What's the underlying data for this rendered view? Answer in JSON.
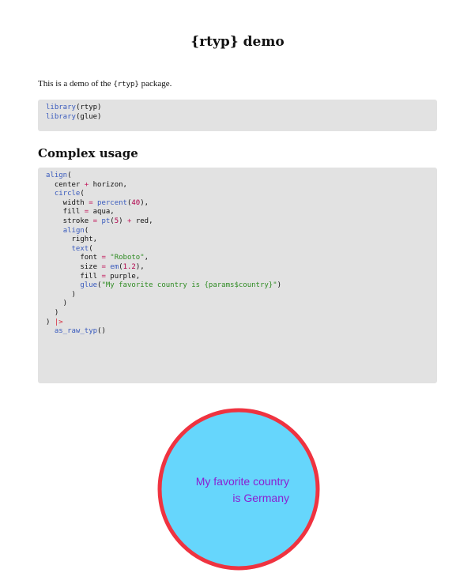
{
  "title": "{rtyp} demo",
  "intro": {
    "before": "This is a demo of the ",
    "package": "{rtyp}",
    "after": " package."
  },
  "setup_code": [
    [
      {
        "t": "library",
        "c": "fn"
      },
      {
        "t": "(rtyp)"
      }
    ],
    [
      {
        "t": "library",
        "c": "fn"
      },
      {
        "t": "(glue)"
      }
    ]
  ],
  "section_heading": "Complex usage",
  "usage_code": [
    [
      {
        "t": "align",
        "c": "fn"
      },
      {
        "t": "("
      }
    ],
    [
      {
        "t": "  center "
      },
      {
        "t": "+",
        "c": "op"
      },
      {
        "t": " horizon,"
      }
    ],
    [
      {
        "t": "  "
      },
      {
        "t": "circle",
        "c": "fn"
      },
      {
        "t": "("
      }
    ],
    [
      {
        "t": "    width "
      },
      {
        "t": "=",
        "c": "op"
      },
      {
        "t": " "
      },
      {
        "t": "percent",
        "c": "fn"
      },
      {
        "t": "("
      },
      {
        "t": "40",
        "c": "num"
      },
      {
        "t": "),"
      }
    ],
    [
      {
        "t": "    fill "
      },
      {
        "t": "=",
        "c": "op"
      },
      {
        "t": " aqua,"
      }
    ],
    [
      {
        "t": "    stroke "
      },
      {
        "t": "=",
        "c": "op"
      },
      {
        "t": " "
      },
      {
        "t": "pt",
        "c": "fn"
      },
      {
        "t": "("
      },
      {
        "t": "5",
        "c": "num"
      },
      {
        "t": ") "
      },
      {
        "t": "+",
        "c": "op"
      },
      {
        "t": " red,"
      }
    ],
    [
      {
        "t": "    "
      },
      {
        "t": "align",
        "c": "fn"
      },
      {
        "t": "("
      }
    ],
    [
      {
        "t": "      right,"
      }
    ],
    [
      {
        "t": "      "
      },
      {
        "t": "text",
        "c": "fn"
      },
      {
        "t": "("
      }
    ],
    [
      {
        "t": "        font "
      },
      {
        "t": "=",
        "c": "op"
      },
      {
        "t": " "
      },
      {
        "t": "\"Roboto\"",
        "c": "str"
      },
      {
        "t": ","
      }
    ],
    [
      {
        "t": "        size "
      },
      {
        "t": "=",
        "c": "op"
      },
      {
        "t": " "
      },
      {
        "t": "em",
        "c": "fn"
      },
      {
        "t": "("
      },
      {
        "t": "1.2",
        "c": "num"
      },
      {
        "t": "),"
      }
    ],
    [
      {
        "t": "        fill "
      },
      {
        "t": "=",
        "c": "op"
      },
      {
        "t": " purple,"
      }
    ],
    [
      {
        "t": "        "
      },
      {
        "t": "glue",
        "c": "fn"
      },
      {
        "t": "("
      },
      {
        "t": "\"My favorite country is {params$country}\"",
        "c": "str"
      },
      {
        "t": ")"
      }
    ],
    [
      {
        "t": "      )"
      }
    ],
    [
      {
        "t": "    )"
      }
    ],
    [
      {
        "t": "  )"
      }
    ],
    [
      {
        "t": ") "
      },
      {
        "t": "|>",
        "c": "pipe"
      }
    ],
    [
      {
        "t": "  "
      },
      {
        "t": "as_raw_typ",
        "c": "fn"
      },
      {
        "t": "()"
      }
    ]
  ],
  "output": {
    "line1": "My favorite country",
    "line2": "is Germany",
    "fill_color": "#66d6fc",
    "stroke_color": "#ef3340",
    "text_color": "#8b1fd1"
  }
}
